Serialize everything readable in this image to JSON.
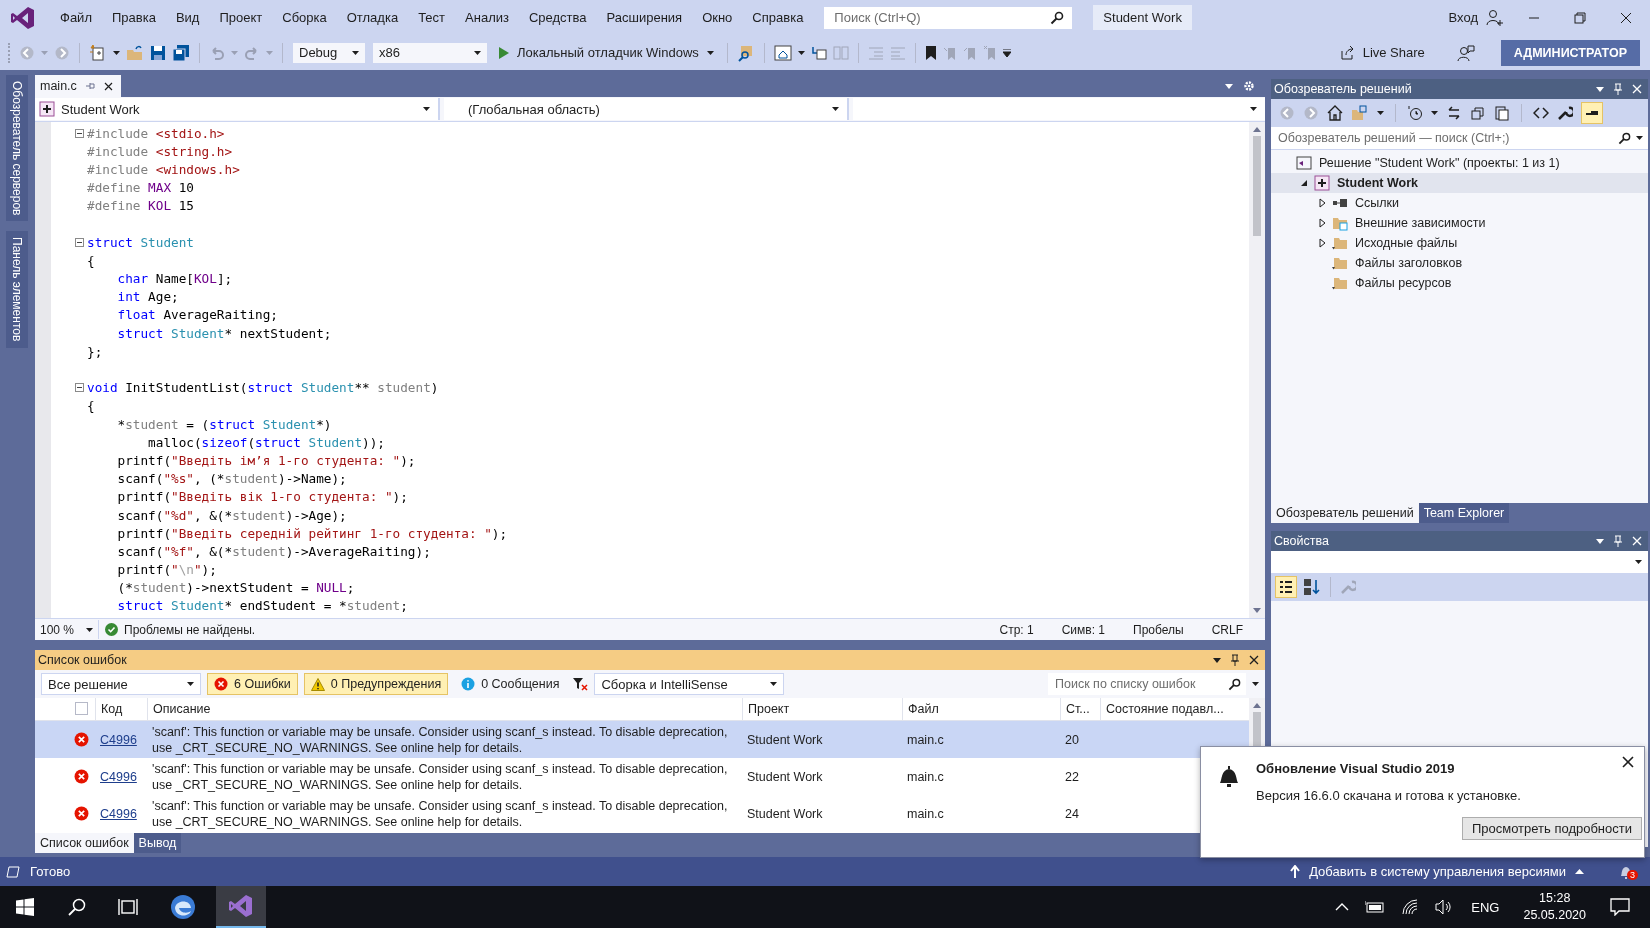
{
  "window": {
    "title": "Student Work",
    "sign_in": "Вход",
    "live_share": "Live Share",
    "admin_badge": "АДМИНИСТРАТОР"
  },
  "menu": [
    "Файл",
    "Правка",
    "Вид",
    "Проект",
    "Сборка",
    "Отладка",
    "Тест",
    "Анализ",
    "Средства",
    "Расширения",
    "Окно",
    "Справка"
  ],
  "search": {
    "placeholder": "Поиск (Ctrl+Q)"
  },
  "toolbar": {
    "configuration": "Debug",
    "platform": "x86",
    "run_target": "Локальный отладчик Windows"
  },
  "side_tabs": [
    "Обозреватель серверов",
    "Панель элементов"
  ],
  "editor": {
    "tabs": [
      {
        "label": "main.c",
        "selected": true
      }
    ],
    "project_scope": "Student Work",
    "global_scope": "(Глобальная область)",
    "lines": [
      {
        "foldable": true,
        "tokens": [
          {
            "kind": "pp",
            "text": "#include "
          },
          {
            "kind": "str",
            "text": "<stdio.h>"
          }
        ]
      },
      {
        "foldable": false,
        "tokens": [
          {
            "kind": "pp",
            "text": "#include "
          },
          {
            "kind": "str",
            "text": "<string.h>"
          }
        ]
      },
      {
        "foldable": false,
        "tokens": [
          {
            "kind": "pp",
            "text": "#include "
          },
          {
            "kind": "str",
            "text": "<windows.h>"
          }
        ]
      },
      {
        "foldable": false,
        "tokens": [
          {
            "kind": "pp",
            "text": "#define "
          },
          {
            "kind": "macro",
            "text": "MAX"
          },
          {
            "kind": "text",
            "text": " 10"
          }
        ]
      },
      {
        "foldable": false,
        "tokens": [
          {
            "kind": "pp",
            "text": "#define "
          },
          {
            "kind": "macro",
            "text": "KOL"
          },
          {
            "kind": "text",
            "text": " 15"
          }
        ]
      },
      {
        "foldable": false
      },
      {
        "foldable": true,
        "tokens": [
          {
            "kind": "kw",
            "text": "struct "
          },
          {
            "kind": "type",
            "text": "Student"
          }
        ]
      },
      {
        "foldable": false,
        "tokens": [
          {
            "kind": "text",
            "text": "{"
          }
        ]
      },
      {
        "foldable": false,
        "tokens": [
          {
            "kind": "kw",
            "text": "    char"
          },
          {
            "kind": "text",
            "text": " Name["
          },
          {
            "kind": "macro",
            "text": "KOL"
          },
          {
            "kind": "text",
            "text": "];"
          }
        ]
      },
      {
        "foldable": false,
        "tokens": [
          {
            "kind": "kw",
            "text": "    int"
          },
          {
            "kind": "text",
            "text": " Age;"
          }
        ]
      },
      {
        "foldable": false,
        "tokens": [
          {
            "kind": "kw",
            "text": "    float"
          },
          {
            "kind": "text",
            "text": " AverageRaiting;"
          }
        ]
      },
      {
        "foldable": false,
        "tokens": [
          {
            "kind": "kw",
            "text": "    struct "
          },
          {
            "kind": "type",
            "text": "Student"
          },
          {
            "kind": "text",
            "text": "* nextStudent;"
          }
        ]
      },
      {
        "foldable": false,
        "tokens": [
          {
            "kind": "text",
            "text": "};"
          }
        ]
      },
      {
        "foldable": false
      },
      {
        "foldable": true,
        "tokens": [
          {
            "kind": "kw",
            "text": "void"
          },
          {
            "kind": "text",
            "text": " InitStudentList("
          },
          {
            "kind": "kw",
            "text": "struct "
          },
          {
            "kind": "type",
            "text": "Student"
          },
          {
            "kind": "text",
            "text": "** "
          },
          {
            "kind": "param",
            "text": "student"
          },
          {
            "kind": "text",
            "text": ")"
          }
        ]
      },
      {
        "foldable": false,
        "tokens": [
          {
            "kind": "text",
            "text": "{"
          }
        ]
      },
      {
        "foldable": false,
        "tokens": [
          {
            "kind": "text",
            "text": "    *"
          },
          {
            "kind": "param",
            "text": "student"
          },
          {
            "kind": "text",
            "text": " = ("
          },
          {
            "kind": "kw",
            "text": "struct "
          },
          {
            "kind": "type",
            "text": "Student"
          },
          {
            "kind": "text",
            "text": "*)"
          }
        ]
      },
      {
        "foldable": false,
        "tokens": [
          {
            "kind": "text",
            "text": "        malloc("
          },
          {
            "kind": "kw",
            "text": "sizeof"
          },
          {
            "kind": "text",
            "text": "("
          },
          {
            "kind": "kw",
            "text": "struct "
          },
          {
            "kind": "type",
            "text": "Student"
          },
          {
            "kind": "text",
            "text": "));"
          }
        ]
      },
      {
        "foldable": false,
        "tokens": [
          {
            "kind": "text",
            "text": "    printf("
          },
          {
            "kind": "str",
            "text": "\"Введіть ім’я 1-го студента: \""
          },
          {
            "kind": "text",
            "text": ");"
          }
        ]
      },
      {
        "foldable": false,
        "tokens": [
          {
            "kind": "text",
            "text": "    scanf("
          },
          {
            "kind": "str",
            "text": "\"%s\""
          },
          {
            "kind": "text",
            "text": ", (*"
          },
          {
            "kind": "param",
            "text": "student"
          },
          {
            "kind": "text",
            "text": ")->Name);"
          }
        ]
      },
      {
        "foldable": false,
        "tokens": [
          {
            "kind": "text",
            "text": "    printf("
          },
          {
            "kind": "str",
            "text": "\"Введіть вік 1-го студента: \""
          },
          {
            "kind": "text",
            "text": ");"
          }
        ]
      },
      {
        "foldable": false,
        "tokens": [
          {
            "kind": "text",
            "text": "    scanf("
          },
          {
            "kind": "str",
            "text": "\"%d\""
          },
          {
            "kind": "text",
            "text": ", &(*"
          },
          {
            "kind": "param",
            "text": "student"
          },
          {
            "kind": "text",
            "text": ")->Age);"
          }
        ]
      },
      {
        "foldable": false,
        "tokens": [
          {
            "kind": "text",
            "text": "    printf("
          },
          {
            "kind": "str",
            "text": "\"Введіть середній рейтинг 1-го студента: \""
          },
          {
            "kind": "text",
            "text": ");"
          }
        ]
      },
      {
        "foldable": false,
        "tokens": [
          {
            "kind": "text",
            "text": "    scanf("
          },
          {
            "kind": "str",
            "text": "\"%f\""
          },
          {
            "kind": "text",
            "text": ", &(*"
          },
          {
            "kind": "param",
            "text": "student"
          },
          {
            "kind": "text",
            "text": ")->AverageRaiting);"
          }
        ]
      },
      {
        "foldable": false,
        "tokens": [
          {
            "kind": "text",
            "text": "    printf("
          },
          {
            "kind": "str",
            "text": "\""
          },
          {
            "kind": "esc",
            "text": "\\n"
          },
          {
            "kind": "str",
            "text": "\""
          },
          {
            "kind": "text",
            "text": ");"
          }
        ]
      },
      {
        "foldable": false,
        "tokens": [
          {
            "kind": "text",
            "text": "    (*"
          },
          {
            "kind": "param",
            "text": "student"
          },
          {
            "kind": "text",
            "text": ")->nextStudent = "
          },
          {
            "kind": "macro",
            "text": "NULL"
          },
          {
            "kind": "text",
            "text": ";"
          }
        ]
      },
      {
        "foldable": false,
        "tokens": [
          {
            "kind": "kw",
            "text": "    struct "
          },
          {
            "kind": "type",
            "text": "Student"
          },
          {
            "kind": "text",
            "text": "* endStudent = *"
          },
          {
            "kind": "param",
            "text": "student"
          },
          {
            "kind": "text",
            "text": ";"
          }
        ]
      }
    ],
    "zoom": "100 %",
    "issues": "Проблемы не найдены.",
    "position": [
      "Стр: 1",
      "Симв: 1",
      "Пробелы",
      "CRLF"
    ]
  },
  "error_list": {
    "title": "Список ошибок",
    "scope": "Все решение",
    "filters": [
      {
        "kind": "error",
        "label": "6 Ошибки",
        "selected": true
      },
      {
        "kind": "warning",
        "label": "0 Предупреждения",
        "selected": true
      },
      {
        "kind": "info",
        "label": "0 Сообщения",
        "selected": false
      }
    ],
    "source": "Сборка и IntelliSense",
    "search_placeholder": "Поиск по списку ошибок",
    "columns": [
      "Код",
      "Описание",
      "Проект",
      "Файл",
      "Ст...",
      "Состояние подавл..."
    ],
    "rows": [
      {
        "code": "C4996",
        "description": "'scanf': This function or variable may be unsafe. Consider using scanf_s instead. To disable deprecation, use _CRT_SECURE_NO_WARNINGS. See online help for details.",
        "project": "Student Work",
        "file": "main.c",
        "line": "20",
        "selected": true
      },
      {
        "code": "C4996",
        "description": "'scanf': This function or variable may be unsafe. Consider using scanf_s instead. To disable deprecation, use _CRT_SECURE_NO_WARNINGS. See online help for details.",
        "project": "Student Work",
        "file": "main.c",
        "line": "22",
        "selected": false
      },
      {
        "code": "C4996",
        "description": "'scanf': This function or variable may be unsafe. Consider using scanf_s instead. To disable deprecation, use _CRT_SECURE_NO_WARNINGS. See online help for details.",
        "project": "Student Work",
        "file": "main.c",
        "line": "24",
        "selected": false
      }
    ],
    "tabs": [
      {
        "label": "Список ошибок",
        "selected": true
      },
      {
        "label": "Вывод",
        "selected": false
      }
    ]
  },
  "solution_explorer": {
    "title": "Обозреватель решений",
    "search_placeholder": "Обозреватель решений — поиск (Ctrl+;)",
    "tree": [
      {
        "kind": "solution",
        "label": "Решение \"Student Work\" (проекты: 1 из 1)",
        "selected": false,
        "children": [
          {
            "kind": "project",
            "label": "Student Work",
            "selected": true,
            "expanded": true,
            "children": [
              {
                "kind": "references",
                "label": "Ссылки",
                "selected": false,
                "expanded": false
              },
              {
                "kind": "external",
                "label": "Внешние зависимости",
                "selected": false,
                "expanded": false
              },
              {
                "kind": "folder",
                "label": "Исходные файлы",
                "selected": false,
                "expanded": false
              },
              {
                "kind": "folder",
                "label": "Файлы заголовков",
                "selected": false
              },
              {
                "kind": "folder",
                "label": "Файлы ресурсов",
                "selected": false
              }
            ]
          }
        ]
      }
    ],
    "tabs": [
      {
        "label": "Обозреватель решений",
        "selected": true
      },
      {
        "label": "Team Explorer",
        "selected": false
      }
    ]
  },
  "properties": {
    "title": "Свойства"
  },
  "notification": {
    "title": "Обновление Visual Studio 2019",
    "message": "Версия 16.6.0 скачана и готова к установке.",
    "button": "Просмотреть подробности"
  },
  "status_bar": {
    "text": "Готово",
    "source_control": "Добавить в систему управления версиями",
    "notification_count": "3"
  },
  "taskbar": {
    "language": "ENG",
    "time": "15:28",
    "date": "25.05.2020"
  }
}
